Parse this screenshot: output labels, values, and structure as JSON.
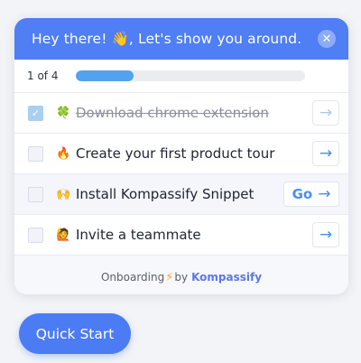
{
  "header": {
    "title": "Hey there! 👋, Let's show you around.",
    "close_icon": "close-icon"
  },
  "progress": {
    "label": "1 of 4",
    "fraction": 0.25,
    "color": "#52a2f0"
  },
  "tasks": [
    {
      "emoji": "🍀",
      "label": "Download chrome extension",
      "done": true,
      "action": "→"
    },
    {
      "emoji": "🔥",
      "label": "Create your first product tour",
      "done": false,
      "action": "→"
    },
    {
      "emoji": "🙌",
      "label": "Install Kompassify Snippet",
      "done": false,
      "action_label": "Go",
      "action": "→"
    },
    {
      "emoji": "🙋",
      "label": "Invite a teammate",
      "done": false,
      "action": "→"
    }
  ],
  "footer": {
    "prefix": "Onboarding",
    "bolt": "⚡",
    "by": "by",
    "brand": "Kompassify"
  },
  "quick_start": {
    "label": "Quick Start"
  },
  "colors": {
    "accent": "#4f7ef5",
    "brand": "#5b78e8"
  }
}
